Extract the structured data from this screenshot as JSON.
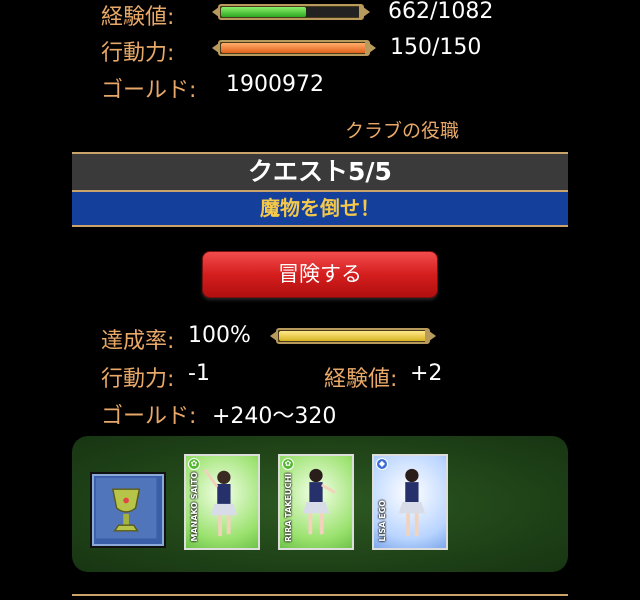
{
  "stats": {
    "exp_label": "経験値:",
    "exp_value": "662/1082",
    "exp_fraction": 0.61,
    "ap_label": "行動力:",
    "ap_value": "150/150",
    "ap_fraction": 1.0,
    "gold_label": "ゴールド:",
    "gold_value": "1900972"
  },
  "club_link": "クラブの役職",
  "quest": {
    "title": "クエスト5/5",
    "subtitle": "魔物を倒せ！",
    "button": "冒険する",
    "rate_label": "達成率:",
    "rate_value": "100%",
    "rate_fraction": 1.0,
    "cost_label": "行動力:",
    "cost_value": "-1",
    "exp_gain_label": "経験値:",
    "exp_gain_value": "+2",
    "gold_gain_label": "ゴールド:",
    "gold_gain_value": "+240〜320"
  },
  "rewards": {
    "cards": [
      {
        "name": "MANAKO SAITO"
      },
      {
        "name": "RIRA TAKEUCHI"
      },
      {
        "name": "LISA EGO"
      }
    ]
  },
  "colors": {
    "label": "#e8a868",
    "exp_fill": "#3fc42e",
    "ap_fill": "#f07a2a",
    "rate_fill": "#f0d23a",
    "button": "#d51e1e",
    "quest_sub_bg": "#143f9a"
  }
}
